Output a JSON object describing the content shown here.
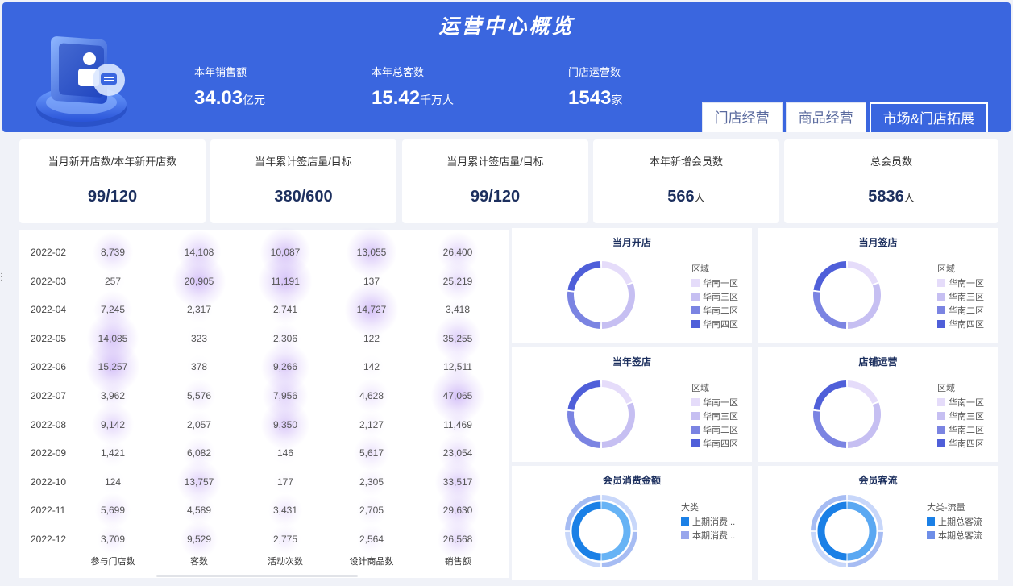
{
  "header": {
    "title": "运营中心概览",
    "kpis": [
      {
        "label": "本年销售额",
        "value": "34.03",
        "unit": "亿元"
      },
      {
        "label": "本年总客数",
        "value": "15.42",
        "unit": "千万人"
      },
      {
        "label": "门店运营数",
        "value": "1543",
        "unit": "家"
      }
    ]
  },
  "tabs": [
    {
      "label": "门店经营",
      "active": false
    },
    {
      "label": "商品经营",
      "active": false
    },
    {
      "label": "市场&门店拓展",
      "active": true
    }
  ],
  "stats": [
    {
      "label": "当月新开店数/本年新开店数",
      "value": "99/120",
      "unit": ""
    },
    {
      "label": "当年累计签店量/目标",
      "value": "380/600",
      "unit": ""
    },
    {
      "label": "当月累计签店量/目标",
      "value": "99/120",
      "unit": ""
    },
    {
      "label": "本年新增会员数",
      "value": "566",
      "unit": "人"
    },
    {
      "label": "总会员数",
      "value": "5836",
      "unit": "人"
    }
  ],
  "heatmap": {
    "columns": [
      "参与门店数",
      "客数",
      "活动次数",
      "设计商品数",
      "销售额"
    ],
    "rows": [
      {
        "date": "2022-02",
        "values": [
          "8,739",
          "14,108",
          "10,087",
          "13,055",
          "26,400"
        ]
      },
      {
        "date": "2022-03",
        "values": [
          "257",
          "20,905",
          "11,191",
          "137",
          "25,219"
        ]
      },
      {
        "date": "2022-04",
        "values": [
          "7,245",
          "2,317",
          "2,741",
          "14,727",
          "3,418"
        ]
      },
      {
        "date": "2022-05",
        "values": [
          "14,085",
          "323",
          "2,306",
          "122",
          "35,255"
        ]
      },
      {
        "date": "2022-06",
        "values": [
          "15,257",
          "378",
          "9,266",
          "142",
          "12,511"
        ]
      },
      {
        "date": "2022-07",
        "values": [
          "3,962",
          "5,576",
          "7,956",
          "4,628",
          "47,065"
        ]
      },
      {
        "date": "2022-08",
        "values": [
          "9,142",
          "2,057",
          "9,350",
          "2,127",
          "11,469"
        ]
      },
      {
        "date": "2022-09",
        "values": [
          "1,421",
          "6,082",
          "146",
          "5,617",
          "23,054"
        ]
      },
      {
        "date": "2022-10",
        "values": [
          "124",
          "13,757",
          "177",
          "2,305",
          "33,517"
        ]
      },
      {
        "date": "2022-11",
        "values": [
          "5,699",
          "4,589",
          "3,431",
          "2,705",
          "29,630"
        ]
      },
      {
        "date": "2022-12",
        "values": [
          "3,709",
          "9,529",
          "2,775",
          "2,564",
          "26,568"
        ]
      }
    ]
  },
  "region_legend": {
    "title": "区域",
    "items": [
      {
        "label": "华南一区",
        "color": "#e5dcfa"
      },
      {
        "label": "华南三区",
        "color": "#c6bff2"
      },
      {
        "label": "华南二区",
        "color": "#7b84e2"
      },
      {
        "label": "华南四区",
        "color": "#4f5fd9"
      }
    ]
  },
  "panels": [
    {
      "title": "当月开店"
    },
    {
      "title": "当月签店"
    },
    {
      "title": "当年签店"
    },
    {
      "title": "店铺运营"
    },
    {
      "title": "会员消费金额",
      "legend_title": "大类",
      "items": [
        {
          "label": "上期消费...",
          "color": "#1b80e6"
        },
        {
          "label": "本期消费...",
          "color": "#98a6ec"
        }
      ]
    },
    {
      "title": "会员客流",
      "legend_title": "大类-流量",
      "items": [
        {
          "label": "上期总客流",
          "color": "#1b80e6"
        },
        {
          "label": "本期总客流",
          "color": "#6e8ee8"
        }
      ]
    }
  ],
  "icons": {
    "logo": "user-badge-icon",
    "edge_handle": "drag-handle-icon"
  }
}
